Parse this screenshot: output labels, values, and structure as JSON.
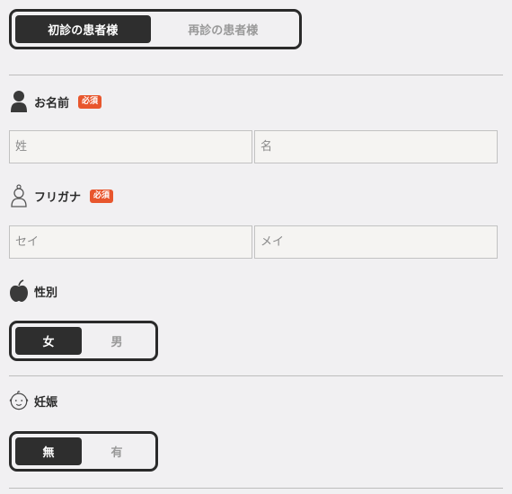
{
  "patient_type": {
    "options": [
      {
        "label": "初診の患者様",
        "active": true
      },
      {
        "label": "再診の患者様",
        "active": false
      }
    ]
  },
  "name": {
    "label": "お名前",
    "required_badge": "必須",
    "icon": "person-icon",
    "last_placeholder": "姓",
    "first_placeholder": "名"
  },
  "kana": {
    "label": "フリガナ",
    "required_badge": "必須",
    "icon": "person-outline-icon",
    "last_placeholder": "セイ",
    "first_placeholder": "メイ"
  },
  "gender": {
    "label": "性別",
    "icon": "apple-icon",
    "options": [
      {
        "label": "女",
        "active": true
      },
      {
        "label": "男",
        "active": false
      }
    ]
  },
  "pregnancy": {
    "label": "妊娠",
    "icon": "baby-face-icon",
    "options": [
      {
        "label": "無",
        "active": true
      },
      {
        "label": "有",
        "active": false
      }
    ]
  }
}
